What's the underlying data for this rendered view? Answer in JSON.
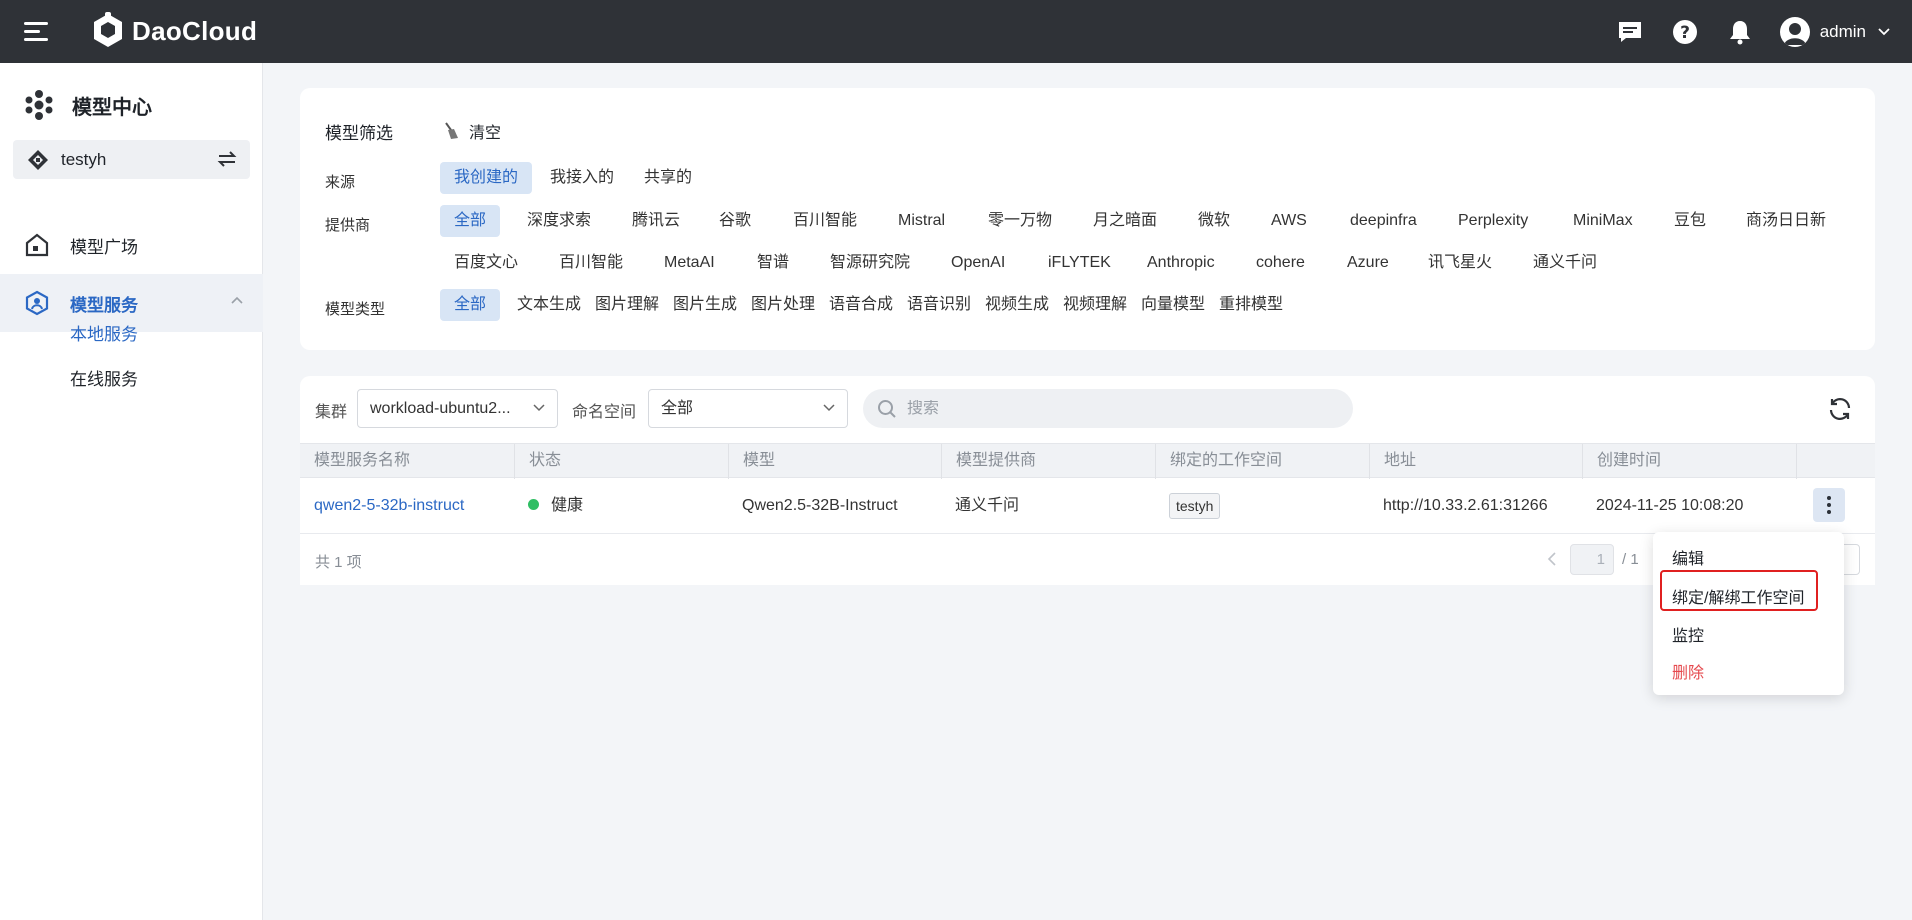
{
  "app": {
    "brand": "DaoCloud",
    "user": "admin"
  },
  "sidebar": {
    "title": "模型中心",
    "workspace": "testyh",
    "nav": [
      {
        "label": "模型广场"
      },
      {
        "label": "模型服务"
      }
    ],
    "sub": [
      {
        "label": "本地服务"
      },
      {
        "label": "在线服务"
      }
    ]
  },
  "filter": {
    "title": "模型筛选",
    "clear": "清空",
    "source_label": "来源",
    "source": [
      "我创建的",
      "我接入的",
      "共享的"
    ],
    "provider_label": "提供商",
    "providers_row1": [
      "全部",
      "深度求索",
      "腾讯云",
      "谷歌",
      "百川智能",
      "Mistral",
      "零一万物",
      "月之暗面",
      "微软",
      "AWS",
      "deepinfra",
      "Perplexity",
      "MiniMax",
      "豆包",
      "商汤日日新"
    ],
    "providers_row2": [
      "百度文心",
      "百川智能",
      "MetaAI",
      "智谱",
      "智源研究院",
      "OpenAI",
      "iFLYTEK",
      "Anthropic",
      "cohere",
      "Azure",
      "讯飞星火",
      "通义千问"
    ],
    "type_label": "模型类型",
    "types": [
      "全部",
      "文本生成",
      "图片理解",
      "图片生成",
      "图片处理",
      "语音合成",
      "语音识别",
      "视频生成",
      "视频理解",
      "向量模型",
      "重排模型"
    ]
  },
  "toolbar": {
    "cluster_label": "集群",
    "cluster_value": "workload-ubuntu2...",
    "namespace_label": "命名空间",
    "namespace_value": "全部",
    "search_placeholder": "搜索"
  },
  "table": {
    "headers": [
      "模型服务名称",
      "状态",
      "模型",
      "模型提供商",
      "绑定的工作空间",
      "地址",
      "创建时间"
    ],
    "rows": [
      {
        "name": "qwen2-5-32b-instruct",
        "status": "健康",
        "model": "Qwen2.5-32B-Instruct",
        "provider": "通义千问",
        "workspace": "testyh",
        "address": "http://10.33.2.61:31266",
        "created": "2024-11-25 10:08:20"
      }
    ],
    "total": "共 1 项",
    "page": "1",
    "pages": "/ 1"
  },
  "menu": {
    "items": [
      "编辑",
      "绑定/解绑工作空间",
      "监控",
      "删除"
    ]
  },
  "colors": {
    "accent": "#2b68c4",
    "topbar": "#2f3237",
    "danger": "#e5484d",
    "healthy": "#2fbe63"
  }
}
